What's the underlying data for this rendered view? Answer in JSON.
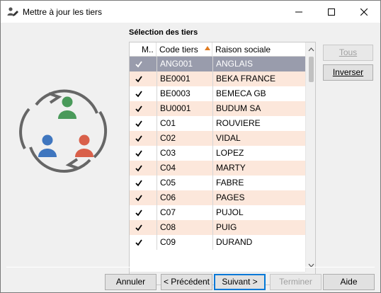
{
  "window": {
    "title": "Mettre à jour les tiers"
  },
  "section": {
    "label": "Sélection des tiers"
  },
  "grid": {
    "columns": [
      "M..",
      "Code tiers",
      "Raison sociale"
    ],
    "sort_column": "Code tiers",
    "rows": [
      {
        "checked": true,
        "code": "ANG001",
        "name": "ANGLAIS",
        "selected": true
      },
      {
        "checked": true,
        "code": "BE0001",
        "name": "BEKA FRANCE",
        "selected": false
      },
      {
        "checked": true,
        "code": "BE0003",
        "name": "BEMECA GB",
        "selected": false
      },
      {
        "checked": true,
        "code": "BU0001",
        "name": "BUDUM SA",
        "selected": false
      },
      {
        "checked": true,
        "code": "C01",
        "name": "ROUVIERE",
        "selected": false
      },
      {
        "checked": true,
        "code": "C02",
        "name": "VIDAL",
        "selected": false
      },
      {
        "checked": true,
        "code": "C03",
        "name": "LOPEZ",
        "selected": false
      },
      {
        "checked": true,
        "code": "C04",
        "name": "MARTY",
        "selected": false
      },
      {
        "checked": true,
        "code": "C05",
        "name": "FABRE",
        "selected": false
      },
      {
        "checked": true,
        "code": "C06",
        "name": "PAGES",
        "selected": false
      },
      {
        "checked": true,
        "code": "C07",
        "name": "PUJOL",
        "selected": false
      },
      {
        "checked": true,
        "code": "C08",
        "name": "PUIG",
        "selected": false
      },
      {
        "checked": true,
        "code": "C09",
        "name": "DURAND",
        "selected": false
      }
    ]
  },
  "side_buttons": {
    "tous": "Tous",
    "inverser": "Inverser"
  },
  "footer_buttons": {
    "annuler": "Annuler",
    "precedent": "< Précédent",
    "suivant": "Suivant >",
    "terminer": "Terminer",
    "aide": "Aide"
  },
  "colors": {
    "selected_row": "#999cac",
    "odd_row": "#fce7db",
    "accent_sort": "#e07a1f",
    "default_button_border": "#0078d7",
    "person_green": "#4a9a5a",
    "person_blue": "#3f76bf",
    "person_red": "#d9604a"
  },
  "icons": {
    "app": "users-edit-icon",
    "minimize": "minimize-icon",
    "maximize": "maximize-icon",
    "close": "close-icon",
    "illustration": "users-sync-icon"
  }
}
